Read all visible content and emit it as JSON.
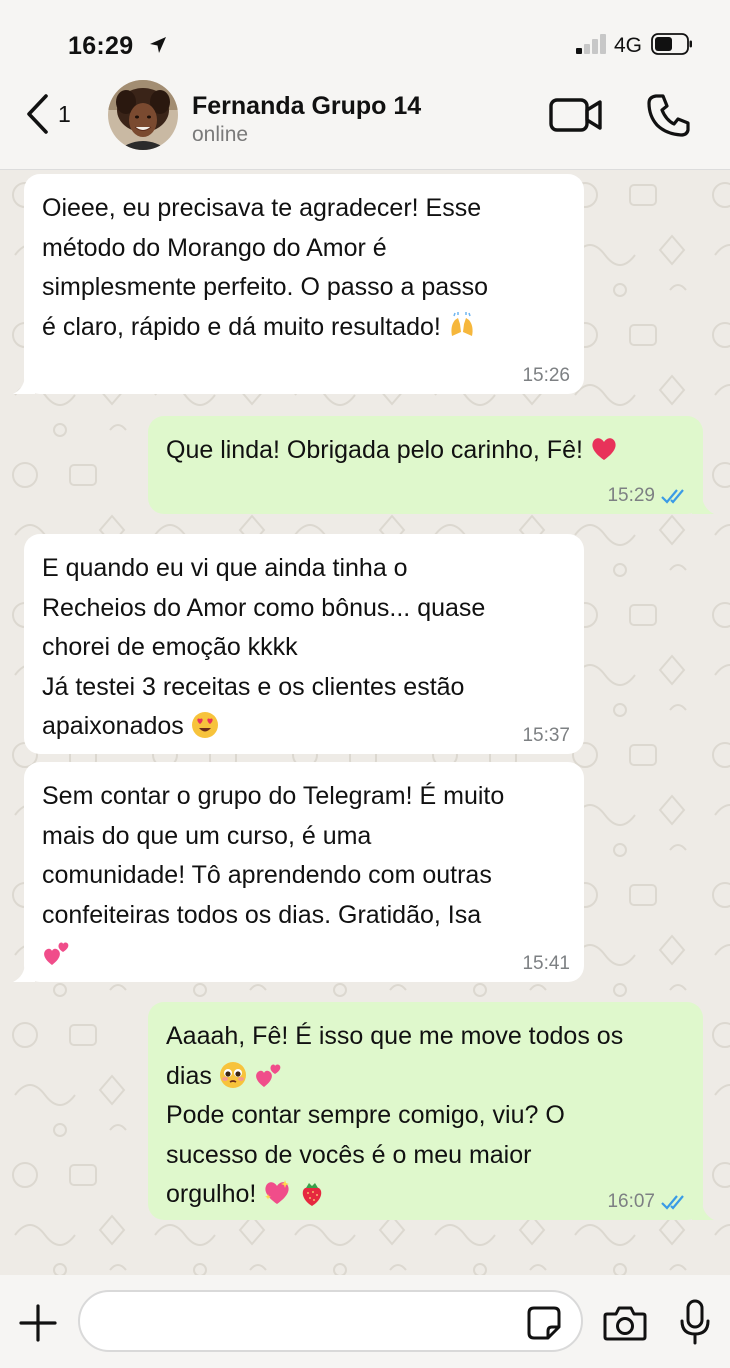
{
  "status_bar": {
    "time": "16:29",
    "network": "4G",
    "icons": [
      "location-arrow-icon",
      "signal-icon",
      "battery-icon"
    ]
  },
  "header": {
    "back_count": "1",
    "contact_name": "Fernanda Grupo 14",
    "contact_status": "online",
    "icons": [
      "back-chevron-icon",
      "video-call-icon",
      "phone-icon"
    ]
  },
  "messages": [
    {
      "direction": "incoming",
      "text": "Oieee, eu precisava te agradecer! Esse\nmétodo do Morango do Amor é\nsimplesmente perfeito. O passo a passo\né claro, rápido e dá muito resultado! ",
      "emoji_after": "raising-hands-emoji",
      "time": "15:26"
    },
    {
      "direction": "outgoing",
      "text": "Que linda! Obrigada pelo carinho, Fê! ",
      "emoji_after": "red-heart-emoji",
      "time": "15:29",
      "status": "read"
    },
    {
      "direction": "incoming",
      "text": "E quando eu vi que ainda tinha o\nRecheios do Amor como bônus... quase\nchorei de emoção kkkk\nJá testei 3 receitas e os clientes estão\napaixonados ",
      "emoji_after": "heart-eyes-emoji",
      "time": "15:37"
    },
    {
      "direction": "incoming",
      "text": "Sem contar o grupo do Telegram! É muito\nmais do que um curso, é uma\ncomunidade! Tô aprendendo com outras\nconfeiteiras todos os dias. Gratidão, Isa\n",
      "emoji_after": "two-hearts-emoji",
      "time": "15:41"
    },
    {
      "direction": "outgoing",
      "text_line1": "Aaaah, Fê! É isso que me move todos os\ndias ",
      "text_line2": "\nPode contar sempre comigo, viu? O\nsucesso de vocês é o meu maior\norgulho! ",
      "emojis": [
        "pleading-face-emoji",
        "two-hearts-emoji",
        "sparkling-heart-emoji",
        "strawberry-emoji"
      ],
      "time": "16:07",
      "status": "read"
    }
  ],
  "composer": {
    "placeholder": "",
    "icons": [
      "plus-icon",
      "sticker-icon",
      "camera-icon",
      "microphone-icon"
    ]
  },
  "colors": {
    "incoming_bubble": "#ffffff",
    "outgoing_bubble": "#dff8cc",
    "read_ticks": "#3a9be6",
    "chat_background": "#eeebe6"
  }
}
